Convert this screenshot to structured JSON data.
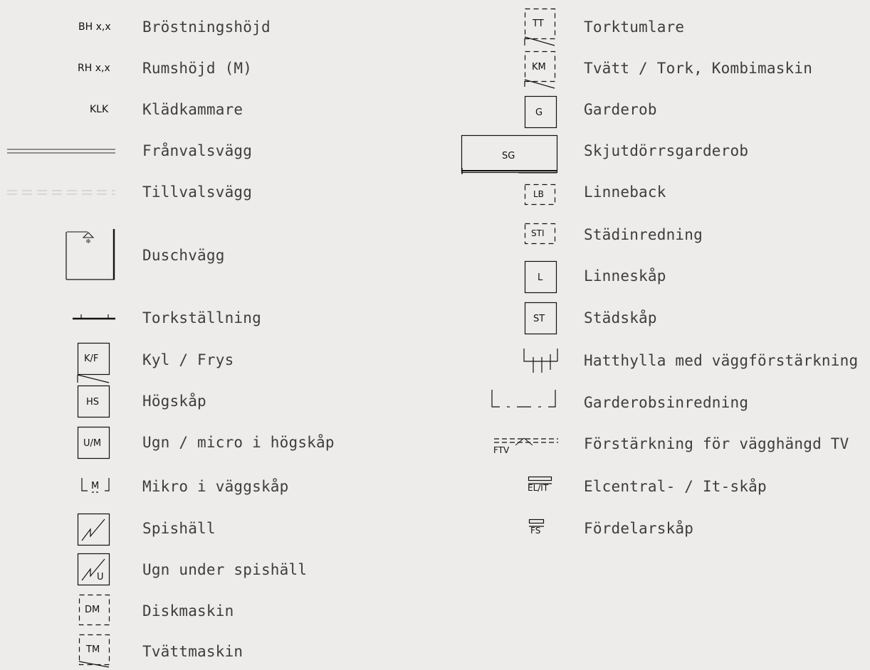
{
  "left": [
    {
      "symbol": "BH x,x",
      "label": "Bröstningshöjd"
    },
    {
      "symbol": "RH x,x",
      "label": "Rumshöjd (M)"
    },
    {
      "symbol": "KLK",
      "label": "Klädkammare"
    },
    {
      "symbol": "",
      "label": "Frånvalsvägg"
    },
    {
      "symbol": "",
      "label": "Tillvalsvägg"
    },
    {
      "symbol": "",
      "label": "Duschvägg"
    },
    {
      "symbol": "",
      "label": "Torkställning"
    },
    {
      "symbol": "K/F",
      "label": "Kyl / Frys"
    },
    {
      "symbol": "HS",
      "label": "Högskåp"
    },
    {
      "symbol": "U/M",
      "label": "Ugn / micro i högskåp"
    },
    {
      "symbol": "M",
      "label": "Mikro i väggskåp"
    },
    {
      "symbol": "",
      "label": "Spishäll"
    },
    {
      "symbol": "U",
      "label": "Ugn under spishäll"
    },
    {
      "symbol": "DM",
      "label": "Diskmaskin"
    },
    {
      "symbol": "TM",
      "label": "Tvättmaskin"
    }
  ],
  "right": [
    {
      "symbol": "TT",
      "label": "Torktumlare"
    },
    {
      "symbol": "KM",
      "label": "Tvätt / Tork, Kombimaskin"
    },
    {
      "symbol": "G",
      "label": "Garderob"
    },
    {
      "symbol": "SG",
      "label": "Skjutdörrsgarderob"
    },
    {
      "symbol": "LB",
      "label": "Linneback"
    },
    {
      "symbol": "STI",
      "label": "Städinredning"
    },
    {
      "symbol": "L",
      "label": "Linneskåp"
    },
    {
      "symbol": "ST",
      "label": "Städskåp"
    },
    {
      "symbol": "",
      "label": "Hatthylla med väggförstärkning"
    },
    {
      "symbol": "",
      "label": "Garderobsinredning"
    },
    {
      "symbol": "FTV",
      "label": "Förstärkning för vägghängd TV"
    },
    {
      "symbol": "EL/IT",
      "label": "Elcentral- / It-skåp"
    },
    {
      "symbol": "FS",
      "label": "Fördelarskåp"
    }
  ],
  "colors": {
    "background": "#edecea",
    "ink": "#111111",
    "text": "#3d3d3d",
    "faint": "#c8c8c8"
  }
}
